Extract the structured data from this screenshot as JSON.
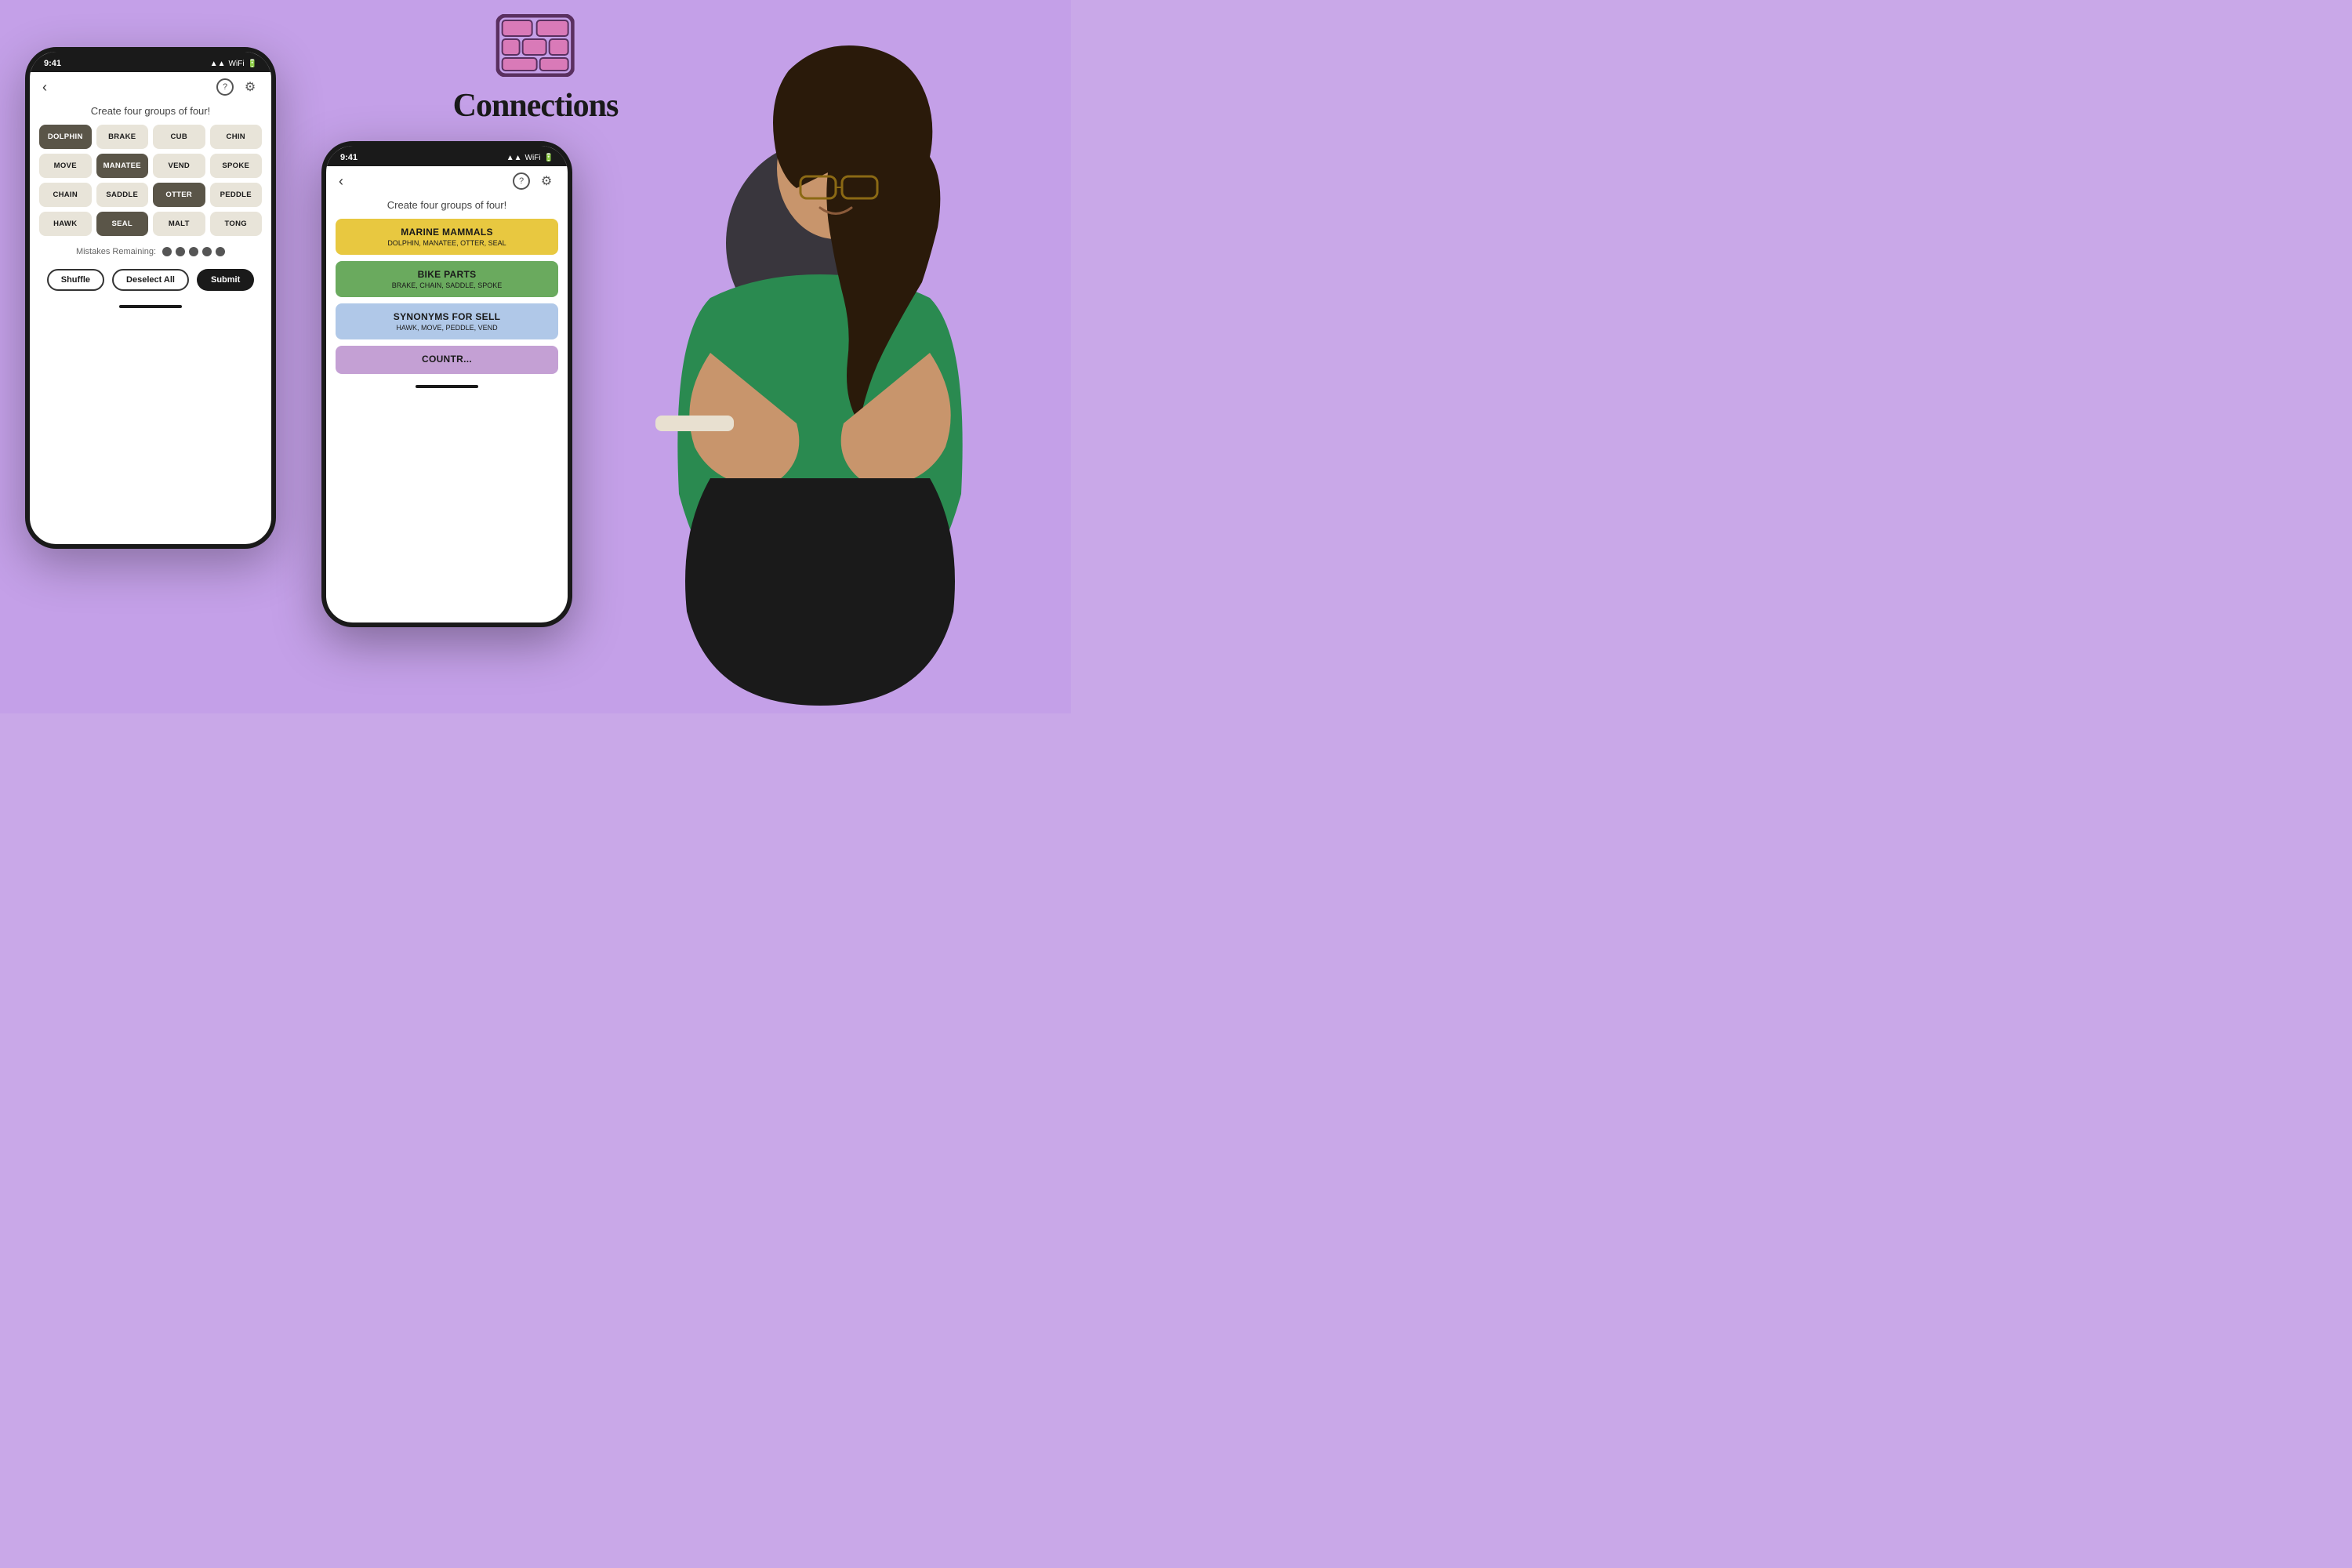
{
  "background_color": "#c4a0e8",
  "logo": {
    "title": "Connections",
    "icon_alt": "brick-grid-icon"
  },
  "phone_left": {
    "status_time": "9:41",
    "subtitle": "Create four groups of four!",
    "tiles": [
      {
        "label": "DOLPHIN",
        "dark": true
      },
      {
        "label": "BRAKE",
        "dark": false
      },
      {
        "label": "CUB",
        "dark": false
      },
      {
        "label": "CHIN",
        "dark": false
      },
      {
        "label": "MOVE",
        "dark": false
      },
      {
        "label": "MANATEE",
        "dark": true
      },
      {
        "label": "VEND",
        "dark": false
      },
      {
        "label": "SPOKE",
        "dark": false
      },
      {
        "label": "CHAIN",
        "dark": false
      },
      {
        "label": "SADDLE",
        "dark": false
      },
      {
        "label": "OTTER",
        "dark": true
      },
      {
        "label": "PEDDLE",
        "dark": false
      },
      {
        "label": "HAWK",
        "dark": false
      },
      {
        "label": "SEAL",
        "dark": true
      },
      {
        "label": "MALT",
        "dark": false
      },
      {
        "label": "TONG",
        "dark": false
      }
    ],
    "mistakes_label": "Mistakes Remaining:",
    "dots": [
      true,
      true,
      true,
      true,
      true
    ],
    "shuffle_label": "Shuffle",
    "deselect_label": "Deselect All",
    "submit_label": "Submit"
  },
  "phone_center": {
    "status_time": "9:41",
    "subtitle": "Create four groups of four!",
    "categories": [
      {
        "color": "yellow",
        "title": "MARINE MAMMALS",
        "words": "DOLPHIN, MANATEE, OTTER, SEAL"
      },
      {
        "color": "green",
        "title": "BIKE PARTS",
        "words": "BRAKE, CHAIN, SADDLE, SPOKE"
      },
      {
        "color": "blue",
        "title": "SYNONYMS FOR SELL",
        "words": "HAWK, MOVE, PEDDLE, VEND"
      },
      {
        "color": "purple",
        "title": "COUNTR...",
        "words": ""
      }
    ]
  }
}
